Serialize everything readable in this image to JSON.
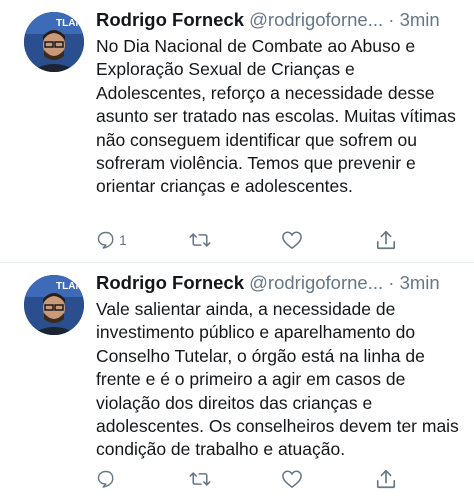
{
  "tweets": [
    {
      "name": "Rodrigo Forneck",
      "handle": "@rodrigoforne...",
      "separator": " · ",
      "time": "3min",
      "text": "No Dia Nacional de Combate ao Abuso e Exploração Sexual de Crianças e Adolescentes, reforço a necessidade desse asunto ser tratado nas escolas. Muitas vítimas não conseguem identificar que sofrem ou sofreram violência. Temos que prevenir e orientar crianças e adolescentes.",
      "reply_count": "1",
      "avatar_banner_text": "TLAM"
    },
    {
      "name": "Rodrigo Forneck",
      "handle": "@rodrigoforne...",
      "separator": " · ",
      "time": "3min",
      "text": "Vale salientar ainda, a necessidade de investimento público e aparelhamento do Conselho Tutelar, o órgão está na linha de frente e é o primeiro a agir em casos de violação dos direitos das crianças e adolescentes. Os conselheiros devem ter mais condição de trabalho e atuação.",
      "reply_count": "",
      "avatar_banner_text": "TLAM"
    }
  ],
  "colors": {
    "text": "#14171a",
    "secondary": "#657786",
    "divider": "#e6ecf0",
    "avatar_bg": "#2b4f8e"
  },
  "icons": [
    "reply-icon",
    "retweet-icon",
    "like-icon",
    "share-icon"
  ]
}
